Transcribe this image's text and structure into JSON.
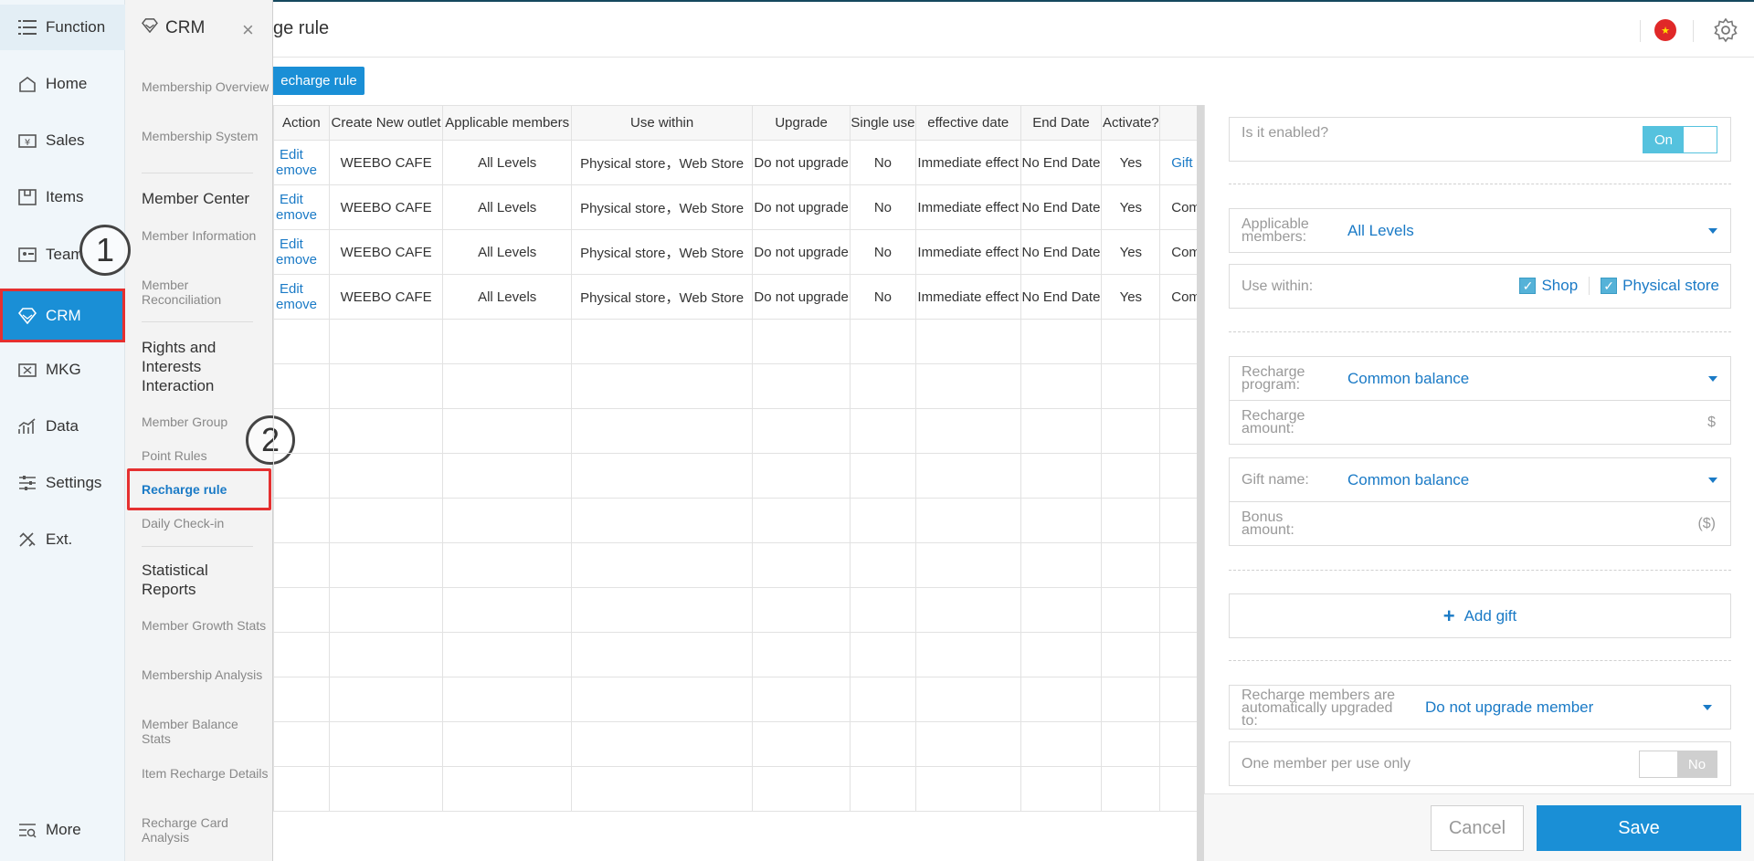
{
  "nav": {
    "function_label": "Function",
    "items": [
      {
        "label": "Home",
        "icon": "home-icon"
      },
      {
        "label": "Sales",
        "icon": "sales-icon"
      },
      {
        "label": "Items",
        "icon": "items-icon"
      },
      {
        "label": "Team",
        "icon": "team-icon"
      },
      {
        "label": "CRM",
        "icon": "crm-icon"
      },
      {
        "label": "MKG",
        "icon": "mkg-icon"
      },
      {
        "label": "Data",
        "icon": "data-icon"
      },
      {
        "label": "Settings",
        "icon": "settings-icon"
      },
      {
        "label": "Ext.",
        "icon": "ext-icon"
      }
    ],
    "more_label": "More"
  },
  "submenu": {
    "title": "CRM",
    "items": {
      "membership_overview": "Membership Overview",
      "membership_system": "Membership System",
      "member_center": "Member Center",
      "member_information": "Member Information",
      "member_reconciliation": "Member Reconciliation",
      "rights_interaction": "Rights and Interests Interaction",
      "member_group": "Member Group",
      "point_rules": "Point Rules",
      "recharge_rule": "Recharge rule",
      "daily_checkin": "Daily Check-in",
      "statistical_reports": "Statistical Reports",
      "member_growth_stats": "Member Growth Stats",
      "membership_analysis": "Membership Analysis",
      "member_balance_stats": "Member Balance Stats",
      "item_recharge_details": "Item Recharge Details",
      "recharge_card_analysis": "Recharge Card Analysis"
    }
  },
  "steps": {
    "one": "1",
    "two": "2"
  },
  "header": {
    "title": "ge rule"
  },
  "toolbar": {
    "add_label": "echarge rule"
  },
  "table": {
    "columns": [
      "Action",
      "Create New outlet",
      "Applicable members",
      "Use within",
      "Upgrade",
      "Single use",
      "effective date",
      "End Date",
      "Activate?",
      ""
    ],
    "rows": [
      {
        "edit": "Edit",
        "remove": "emove",
        "outlet": "WEEBO CAFE",
        "members": "All Levels",
        "use_within": "Physical store，Web Store",
        "upgrade": "Do not upgrade",
        "single_use": "No",
        "effective": "Immediate effect",
        "end": "No End Date",
        "activate": "Yes",
        "gift": "Gift"
      },
      {
        "edit": "Edit",
        "remove": "emove",
        "outlet": "WEEBO CAFE",
        "members": "All Levels",
        "use_within": "Physical store，Web Store",
        "upgrade": "Do not upgrade",
        "single_use": "No",
        "effective": "Immediate effect",
        "end": "No End Date",
        "activate": "Yes",
        "gift": "Com"
      },
      {
        "edit": "Edit",
        "remove": "emove",
        "outlet": "WEEBO CAFE",
        "members": "All Levels",
        "use_within": "Physical store，Web Store",
        "upgrade": "Do not upgrade",
        "single_use": "No",
        "effective": "Immediate effect",
        "end": "No End Date",
        "activate": "Yes",
        "gift": "Com"
      },
      {
        "edit": "Edit",
        "remove": "emove",
        "outlet": "WEEBO CAFE",
        "members": "All Levels",
        "use_within": "Physical store，Web Store",
        "upgrade": "Do not upgrade",
        "single_use": "No",
        "effective": "Immediate effect",
        "end": "No End Date",
        "activate": "Yes",
        "gift": "Com"
      }
    ]
  },
  "form": {
    "enabled_label": "Is it enabled?",
    "enabled_value": "On",
    "members_label": "Applicable members:",
    "members_value": "All Levels",
    "use_within_label": "Use within:",
    "use_within_shop": "Shop",
    "use_within_physical": "Physical store",
    "program_label": "Recharge program:",
    "program_value": "Common balance",
    "amount_label": "Recharge amount:",
    "amount_unit": "$",
    "gift_name_label": "Gift name:",
    "gift_name_value": "Common balance",
    "bonus_label": "Bonus amount:",
    "bonus_unit": "($)",
    "add_gift_label": "Add gift",
    "upgrade_label": "Recharge members are automatically upgraded to:",
    "upgrade_value": "Do not upgrade member",
    "one_per_use_label": "One member per use only",
    "one_per_use_value": "No",
    "cancel_label": "Cancel",
    "save_label": "Save"
  },
  "colors": {
    "accent": "#1a8fd6",
    "highlight": "#e53030",
    "toggle": "#55c2de"
  }
}
